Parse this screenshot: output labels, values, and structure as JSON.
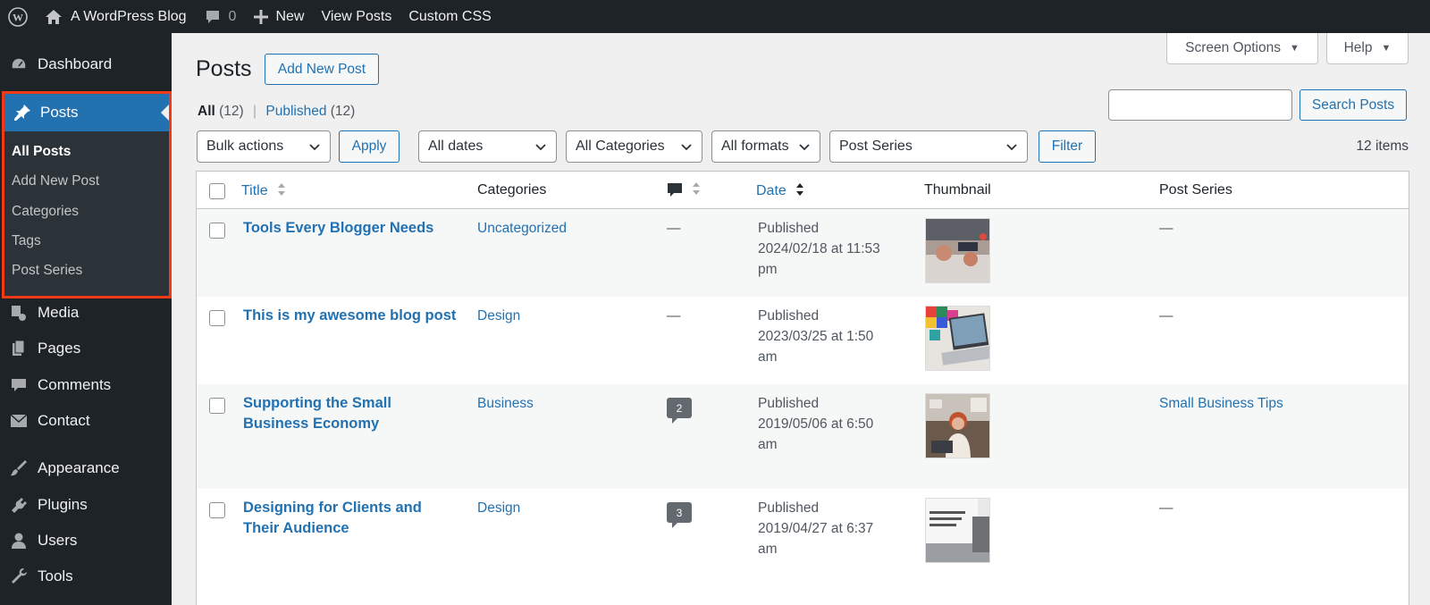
{
  "adminbar": {
    "site_name": "A WordPress Blog",
    "comments_count": "0",
    "new_label": "New",
    "view_posts": "View Posts",
    "custom_css": "Custom CSS"
  },
  "sidebar": {
    "dashboard": "Dashboard",
    "posts": "Posts",
    "posts_sub": [
      "All Posts",
      "Add New Post",
      "Categories",
      "Tags",
      "Post Series"
    ],
    "media": "Media",
    "pages": "Pages",
    "comments": "Comments",
    "contact": "Contact",
    "appearance": "Appearance",
    "plugins": "Plugins",
    "users": "Users",
    "tools": "Tools"
  },
  "header": {
    "screen_options": "Screen Options",
    "help": "Help",
    "title": "Posts",
    "add_new": "Add New Post"
  },
  "views": {
    "all_label": "All",
    "all_count": "(12)",
    "separator": "|",
    "published_label": "Published",
    "published_count": "(12)"
  },
  "search": {
    "value": "",
    "button": "Search Posts"
  },
  "filters": {
    "bulk_actions": "Bulk actions",
    "apply": "Apply",
    "dates": "All dates",
    "categories": "All Categories",
    "formats": "All formats",
    "series": "Post Series",
    "filter": "Filter",
    "items_count": "12 items"
  },
  "table": {
    "headers": {
      "title": "Title",
      "categories": "Categories",
      "date": "Date",
      "thumbnail": "Thumbnail",
      "post_series": "Post Series"
    },
    "rows": [
      {
        "title_line1": "Tools Every Blogger Needs",
        "title_line2": "",
        "category": "Uncategorized",
        "comments": "—",
        "status": "Published",
        "date_line1": "2024/02/18 at 11:53",
        "date_line2": "pm",
        "series": "—"
      },
      {
        "title_line1": "This is my awesome blog post",
        "title_line2": "",
        "category": "Design",
        "comments": "—",
        "status": "Published",
        "date_line1": "2023/03/25 at 1:50",
        "date_line2": "am",
        "series": "—"
      },
      {
        "title_line1": "Supporting the Small",
        "title_line2": "Business Economy",
        "category": "Business",
        "comments": "2",
        "status": "Published",
        "date_line1": "2019/05/06 at 6:50",
        "date_line2": "am",
        "series": "Small Business Tips"
      },
      {
        "title_line1": "Designing for Clients and",
        "title_line2": "Their Audience",
        "category": "Design",
        "comments": "3",
        "status": "Published",
        "date_line1": "2019/04/27 at 6:37",
        "date_line2": "am",
        "series": "—"
      }
    ]
  },
  "colors": {
    "admin_dark": "#1d2327",
    "accent_blue": "#2271b1",
    "highlight_red": "#f03a17"
  }
}
